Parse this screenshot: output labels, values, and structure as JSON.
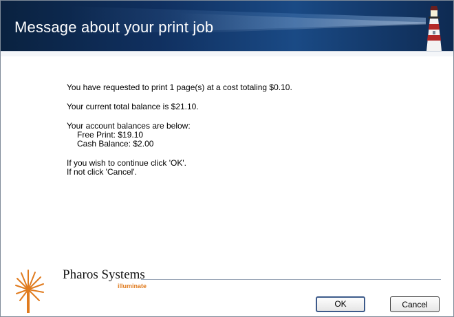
{
  "dialog": {
    "title": "Message about your print job"
  },
  "message": {
    "line1": "You have requested to print 1 page(s) at a cost totaling $0.10.",
    "line2": "Your current total balance is $21.10.",
    "line3": "Your account balances are below:",
    "balance_free": "Free Print: $19.10",
    "balance_cash": "Cash Balance: $2.00",
    "line4": "If you wish to continue click 'OK'.",
    "line5": "If not click 'Cancel'."
  },
  "brand": {
    "name": "Pharos Systems",
    "tagline": "illuminate",
    "accent_color": "#e07b1e"
  },
  "buttons": {
    "ok_label": "OK",
    "cancel_label": "Cancel"
  }
}
